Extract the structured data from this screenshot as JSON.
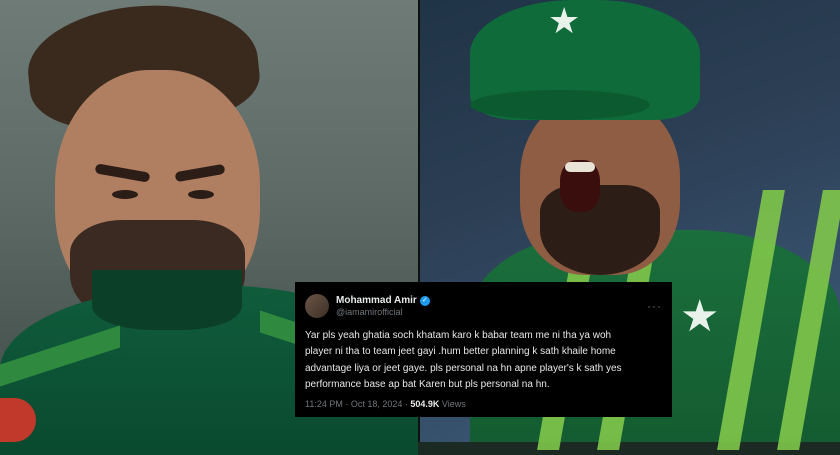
{
  "tweet": {
    "name": "Mohammad Amir",
    "handle": "@iamamirofficial",
    "more_icon": "more-horizontal-icon",
    "verified_icon": "verified-badge-icon",
    "body": "Yar pls yeah ghatia soch khatam karo k babar team me ni tha ya woh\nplayer ni tha to team jeet gayi .hum better  planning k sath khaile home\nadvantage  liya or jeet gaye. pls personal  na hn apne player's k sath yes\nperformance base ap bat Karen but pls personal  na hn.",
    "time": "11:24 PM · Oct 18, 2024 · ",
    "views": "504.9K",
    "views_label": " Views"
  },
  "colors": {
    "tweet_bg": "#000000",
    "text": "#e7e9ea",
    "muted": "#71767b",
    "verified": "#1d9bf0",
    "jersey_green": "#0f5c3b"
  }
}
